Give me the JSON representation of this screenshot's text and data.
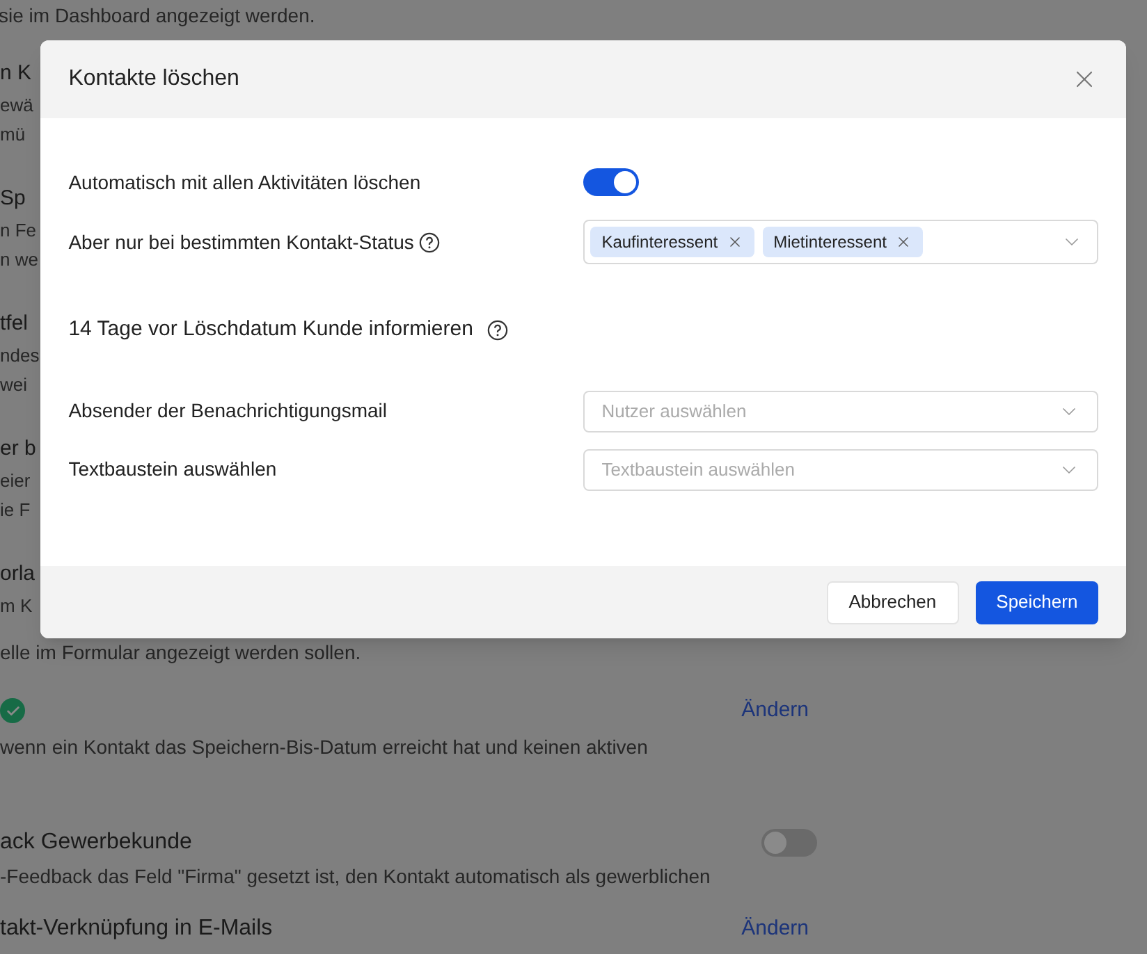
{
  "background": {
    "top_note": "sie im Dashboard angezeigt werden.",
    "fragment_sections": [
      {
        "heading": "n K",
        "lines": [
          "ewä",
          "mü"
        ]
      },
      {
        "heading": "Sp",
        "lines": [
          "n Fe",
          "n we"
        ]
      },
      {
        "heading": "tfel",
        "lines": [
          "ndes",
          "wei"
        ]
      },
      {
        "heading": "er b",
        "lines": [
          "eier",
          "ie F"
        ]
      },
      {
        "heading": "orla",
        "lines": [
          "m K"
        ]
      }
    ],
    "continued_line": "elle im Formular angezeigt werden sollen.",
    "sections": [
      {
        "kind": "check",
        "checked": true,
        "link": "Ändern",
        "text": "wenn ein Kontakt das Speichern-Bis-Datum erreicht hat und keinen aktiven"
      },
      {
        "kind": "toggle",
        "title": "ack Gewerbekunde",
        "on": false,
        "text": "-Feedback das Feld \"Firma\" gesetzt ist, den Kontakt automatisch als gewerblichen"
      },
      {
        "kind": "link",
        "title": "takt-Verknüpfung in E-Mails",
        "link": "Ändern"
      }
    ]
  },
  "modal": {
    "title": "Kontakte löschen",
    "rows": [
      {
        "kind": "toggle",
        "label": "Automatisch mit allen Aktivitäten löschen",
        "on": true
      },
      {
        "kind": "multiselect",
        "label": "Aber nur bei bestimmten Kontakt-Status",
        "help": true,
        "tags": [
          "Kaufinteressent",
          "Mietinteressent"
        ]
      },
      {
        "kind": "heading",
        "label": "14 Tage vor Löschdatum Kunde informieren",
        "help": true
      },
      {
        "kind": "select",
        "label": "Absender der Benachrichtigungsmail",
        "placeholder": "Nutzer auswählen"
      },
      {
        "kind": "select",
        "label": "Textbaustein auswählen",
        "placeholder": "Textbaustein auswählen"
      }
    ],
    "buttons": [
      {
        "label": "Abbrechen",
        "primary": false
      },
      {
        "label": "Speichern",
        "primary": true
      }
    ]
  }
}
